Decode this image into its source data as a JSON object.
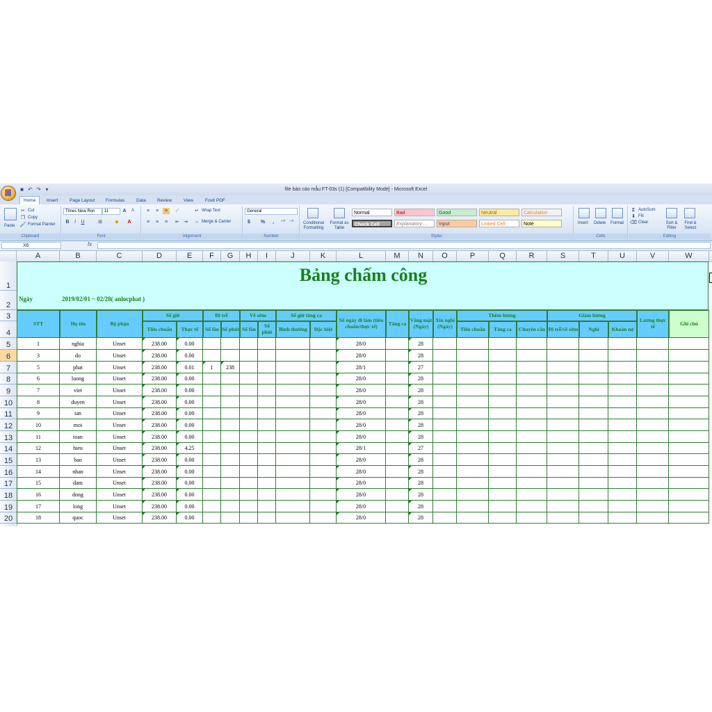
{
  "window": {
    "title": "file báo cáo mẫu FT-03s (1)  [Compatibility Mode] - Microsoft Excel"
  },
  "qat": {
    "save": "save-icon",
    "undo": "undo-icon",
    "redo": "redo-icon",
    "more": "▾"
  },
  "tabs": [
    "Home",
    "Insert",
    "Page Layout",
    "Formulas",
    "Data",
    "Review",
    "View",
    "Foxit PDF"
  ],
  "ribbon": {
    "clipboard": {
      "paste": "Paste",
      "cut": "Cut",
      "copy": "Copy",
      "format_painter": "Format Painter",
      "label": "Clipboard"
    },
    "font": {
      "name": "Times New Ron",
      "size": "11",
      "label": "Font"
    },
    "alignment": {
      "wrap": "Wrap Text",
      "merge": "Merge & Center",
      "label": "Alignment"
    },
    "number": {
      "format": "General",
      "currency": "$",
      "percent": "%",
      "comma": ",",
      "label": "Number"
    },
    "styles": {
      "conditional": "Conditional Formatting",
      "format_table": "Format as Table",
      "cells": [
        {
          "label": "Normal",
          "bg": "#ffffff",
          "fg": "#000000"
        },
        {
          "label": "Bad",
          "bg": "#ffc7ce",
          "fg": "#9c0006"
        },
        {
          "label": "Good",
          "bg": "#c6efce",
          "fg": "#006100"
        },
        {
          "label": "Neutral",
          "bg": "#ffeb9c",
          "fg": "#9c6500"
        },
        {
          "label": "Calculation",
          "bg": "#f2f2f2",
          "fg": "#fa7d00"
        },
        {
          "label": "Check Cell",
          "bg": "#a5a5a5",
          "fg": "#ffffff"
        },
        {
          "label": "Explanatory ...",
          "bg": "#ffffff",
          "fg": "#7f7f7f"
        },
        {
          "label": "Input",
          "bg": "#ffcc99",
          "fg": "#3f3f76"
        },
        {
          "label": "Linked Cell",
          "bg": "#ffffff",
          "fg": "#fa7d00"
        },
        {
          "label": "Note",
          "bg": "#ffffcc",
          "fg": "#000000"
        }
      ],
      "label": "Styles"
    },
    "cells": {
      "insert": "Insert",
      "delete": "Delete",
      "format": "Format",
      "label": "Cells"
    },
    "editing": {
      "autosum": "AutoSum",
      "fill": "Fill",
      "clear": "Clear",
      "sort": "Sort & Filter",
      "find": "Find & Select",
      "label": "Editing"
    }
  },
  "formula_bar": {
    "name_box": "X6",
    "fx": "fx",
    "value": ""
  },
  "columns": [
    "A",
    "B",
    "C",
    "D",
    "E",
    "F",
    "G",
    "H",
    "I",
    "J",
    "K",
    "L",
    "M",
    "N",
    "O",
    "P",
    "Q",
    "R",
    "S",
    "T",
    "U",
    "V",
    "W"
  ],
  "rows": [
    "1",
    "2",
    "3",
    "4",
    "5",
    "6",
    "7",
    "8",
    "9",
    "10",
    "11",
    "12",
    "13",
    "14",
    "15",
    "16",
    "17",
    "18",
    "19",
    "20"
  ],
  "selected_row": "6",
  "sheet": {
    "title": "Bảng chấm công",
    "date_label": "Ngày",
    "date_value": "2019/02/01 ~ 02/28( anlocphat )",
    "headers": {
      "stt": "STT",
      "ho_ten": "Họ tên",
      "bo_phan": "Bộ phận",
      "so_gio": "Số giờ",
      "tieu_chuan": "Tiêu chuẩn",
      "thuc_te": "Thực tế",
      "di_tre": "Đi trễ",
      "so_lan": "Số lần",
      "so_phut": "Số phút",
      "ve_som": "Về sớm",
      "so_lan2": "Số lần",
      "so_phut2": "Số phút",
      "so_gio_tang_ca": "Số giờ tăng ca",
      "binh_thuong": "Bình thường",
      "dac_biet": "Đặc biệt",
      "so_ngay_di_lam": "Số ngày đi làm (tiêu chuẩn/thực tế)",
      "tang_ca": "Tăng ca",
      "vang_mat": "Vắng mặt (Ngày)",
      "xin_nghi": "Xin nghỉ (Ngày)",
      "them_luong": "Thêm lương",
      "tl_tieu_chuan": "Tiêu chuẩn",
      "tl_tang_ca": "Tăng ca",
      "tl_chuyen_can": "Chuyên cần",
      "giam_luong": "Giảm lương",
      "gl_di_tre": "Đi trễ/về sớm",
      "gl_nghi": "Nghỉ",
      "gl_khoan_no": "Khoản nợ",
      "luong_thuc_te": "Lương thực tế",
      "ghi_chu": "Ghi chú"
    },
    "rows": [
      {
        "stt": "1",
        "name": "nghia",
        "dept": "Unset",
        "std": "238.00",
        "act": "0.00",
        "late_n": "",
        "late_m": "",
        "days": "28/0",
        "absent": "28"
      },
      {
        "stt": "3",
        "name": "do",
        "dept": "Unset",
        "std": "238.00",
        "act": "0.00",
        "late_n": "",
        "late_m": "",
        "days": "28/0",
        "absent": "28"
      },
      {
        "stt": "5",
        "name": "phat",
        "dept": "Unset",
        "std": "238.00",
        "act": "0.01",
        "late_n": "1",
        "late_m": "238",
        "days": "28/1",
        "absent": "27"
      },
      {
        "stt": "6",
        "name": "luong",
        "dept": "Unset",
        "std": "238.00",
        "act": "0.00",
        "late_n": "",
        "late_m": "",
        "days": "28/0",
        "absent": "28"
      },
      {
        "stt": "7",
        "name": "viet",
        "dept": "Unset",
        "std": "238.00",
        "act": "0.00",
        "late_n": "",
        "late_m": "",
        "days": "28/0",
        "absent": "28"
      },
      {
        "stt": "8",
        "name": "duyen",
        "dept": "Unset",
        "std": "238.00",
        "act": "0.00",
        "late_n": "",
        "late_m": "",
        "days": "28/0",
        "absent": "28"
      },
      {
        "stt": "9",
        "name": "tan",
        "dept": "Unset",
        "std": "238.00",
        "act": "0.00",
        "late_n": "",
        "late_m": "",
        "days": "28/0",
        "absent": "28"
      },
      {
        "stt": "10",
        "name": "moi",
        "dept": "Unset",
        "std": "238.00",
        "act": "0.00",
        "late_n": "",
        "late_m": "",
        "days": "28/0",
        "absent": "28"
      },
      {
        "stt": "11",
        "name": "toan",
        "dept": "Unset",
        "std": "238.00",
        "act": "0.00",
        "late_n": "",
        "late_m": "",
        "days": "28/0",
        "absent": "28"
      },
      {
        "stt": "12",
        "name": "hieu",
        "dept": "Unset",
        "std": "238.00",
        "act": "4.25",
        "late_n": "",
        "late_m": "",
        "days": "28/1",
        "absent": "27"
      },
      {
        "stt": "13",
        "name": "bao",
        "dept": "Unset",
        "std": "238.00",
        "act": "0.00",
        "late_n": "",
        "late_m": "",
        "days": "28/0",
        "absent": "28"
      },
      {
        "stt": "14",
        "name": "nhan",
        "dept": "Unset",
        "std": "238.00",
        "act": "0.00",
        "late_n": "",
        "late_m": "",
        "days": "28/0",
        "absent": "28"
      },
      {
        "stt": "15",
        "name": "dam",
        "dept": "Unset",
        "std": "238.00",
        "act": "0.00",
        "late_n": "",
        "late_m": "",
        "days": "28/0",
        "absent": "28"
      },
      {
        "stt": "16",
        "name": "dong",
        "dept": "Unset",
        "std": "238.00",
        "act": "0.00",
        "late_n": "",
        "late_m": "",
        "days": "28/0",
        "absent": "28"
      },
      {
        "stt": "17",
        "name": "long",
        "dept": "Unset",
        "std": "238.00",
        "act": "0.00",
        "late_n": "",
        "late_m": "",
        "days": "28/0",
        "absent": "28"
      },
      {
        "stt": "18",
        "name": "quoc",
        "dept": "Unset",
        "std": "238.00",
        "act": "0.00",
        "late_n": "",
        "late_m": "",
        "days": "28/0",
        "absent": "28"
      }
    ]
  }
}
